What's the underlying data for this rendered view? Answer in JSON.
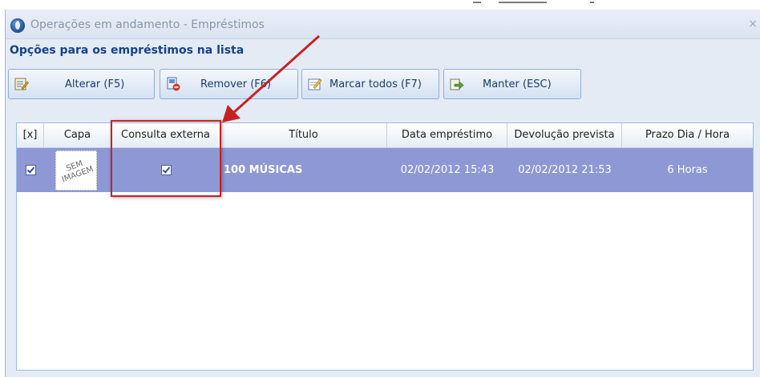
{
  "window": {
    "title": "Operações em andamento - Empréstimos",
    "close_glyph": "×"
  },
  "section_title": "Opções para os empréstimos na lista",
  "toolbar": {
    "buttons": [
      {
        "label": "Alterar (F5)",
        "icon": "edit-icon"
      },
      {
        "label": "Remover (F6)",
        "icon": "remove-icon"
      },
      {
        "label": "Marcar todos (F7)",
        "icon": "mark-all-icon"
      },
      {
        "label": "Manter (ESC)",
        "icon": "keep-icon"
      }
    ]
  },
  "table": {
    "columns": [
      "[x]",
      "Capa",
      "Consulta externa",
      "Título",
      "Data empréstimo",
      "Devolução prevista",
      "Prazo Dia / Hora"
    ],
    "rows": [
      {
        "selected": true,
        "cover": "SEM IMAGEM",
        "consulta_externa": true,
        "titulo": "100 MÚSICAS",
        "data_emprestimo": "02/02/2012 15:43",
        "devolucao_prevista": "02/02/2012 21:53",
        "prazo": "6 Horas"
      }
    ]
  },
  "colors": {
    "accent_title": "#15428b",
    "selected_row": "#8d98d4",
    "annotation": "#c72222"
  }
}
